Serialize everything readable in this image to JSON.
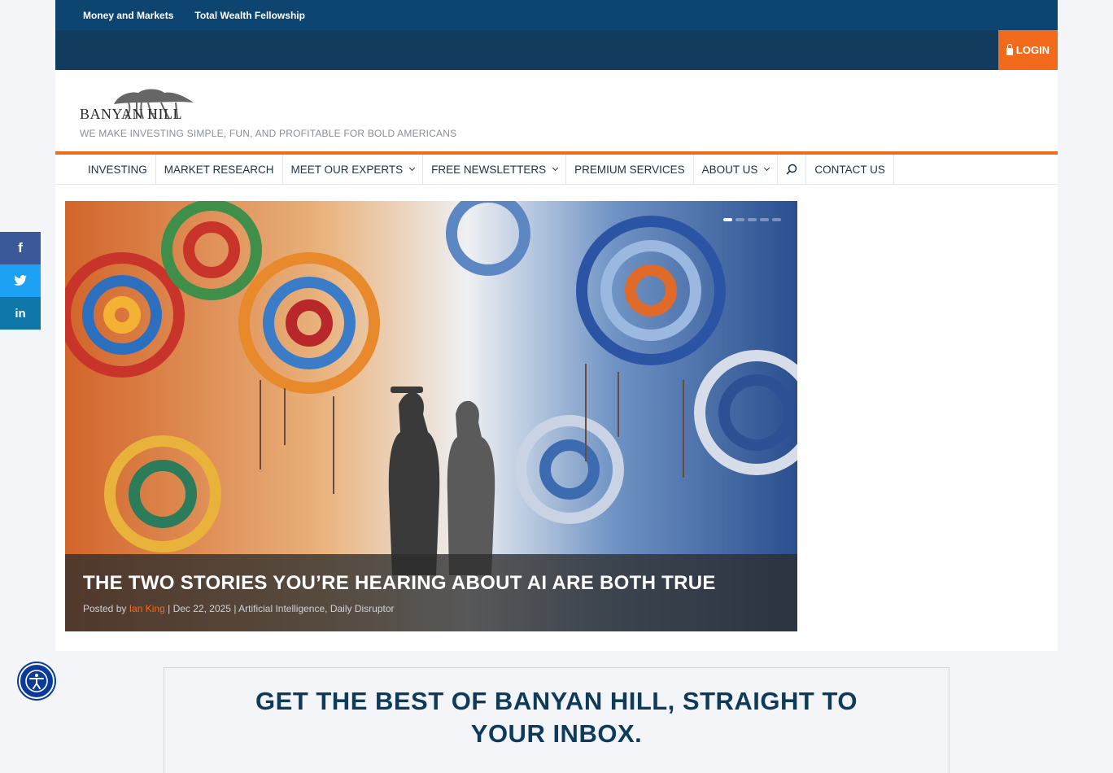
{
  "topbar": {
    "links": [
      "Money and Markets",
      "Total Wealth Fellowship"
    ]
  },
  "login": {
    "label": "LOGIN"
  },
  "brand": {
    "logo_text": "BANYAN HILL",
    "tagline": "WE MAKE INVESTING SIMPLE, FUN, AND PROFITABLE FOR BOLD AMERICANS"
  },
  "nav": {
    "items": [
      {
        "label": "INVESTING"
      },
      {
        "label": "MARKET RESEARCH"
      },
      {
        "label": "MEET OUR EXPERTS"
      },
      {
        "label": "FREE NEWSLETTERS"
      },
      {
        "label": "PREMIUM SERVICES"
      },
      {
        "label": "ABOUT US"
      },
      {
        "label": "CONTACT US"
      }
    ]
  },
  "hero": {
    "title": "THE TWO STORIES YOU’RE HEARING ABOUT AI ARE BOTH TRUE",
    "posted_by": "Posted by",
    "author": "Ian King",
    "separator": "|",
    "date": "Dec 22, 2025",
    "categories": "Artificial Intelligence, Daily Disruptor"
  },
  "signup": {
    "title": "GET THE BEST OF BANYAN HILL, STRAIGHT TO YOUR INBOX."
  },
  "colors": {
    "accent": "#f26b1d",
    "topbar": "#0e4470",
    "navtext": "#1d3247"
  },
  "icons": [
    "lock-icon",
    "search-icon",
    "chevron-down-icon",
    "facebook-icon",
    "twitter-icon",
    "linkedin-icon",
    "accessibility-icon"
  ]
}
